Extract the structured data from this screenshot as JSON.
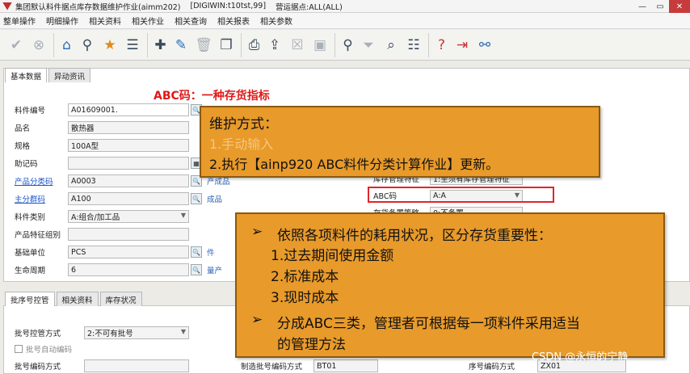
{
  "window": {
    "title": "集团默认料件据点库存数据维护作业(aimm202)",
    "db": "[DIGIWIN:t10tst,99]",
    "site": "营运据点:ALL(ALL)",
    "minimize": "—",
    "restore": "▭",
    "close": "✕"
  },
  "menu": [
    "整单操作",
    "明细操作",
    "相关资料",
    "相关作业",
    "相关查询",
    "相关报表",
    "相关参数"
  ],
  "toolbar_icons": [
    "check-icon",
    "cancel-icon",
    "home-icon",
    "pin-icon",
    "star-icon",
    "list-icon",
    "add-icon",
    "edit-icon",
    "delete-icon",
    "copy-icon",
    "print-icon",
    "export-icon",
    "excel-icon",
    "image-icon",
    "search-icon",
    "filter-icon",
    "query-icon",
    "tree-icon",
    "help-icon",
    "exit-icon",
    "attach-icon"
  ],
  "tabs": {
    "basic": "基本数据",
    "change": "异动资讯"
  },
  "annotation": "ABC码：一种存货指标",
  "fields": [
    {
      "label": "料件编号",
      "value": "A01609001."
    },
    {
      "label": "品名",
      "value": "散热器"
    },
    {
      "label": "规格",
      "value": "100A型"
    },
    {
      "label": "助记码",
      "value": ""
    },
    {
      "label": "产品分类码",
      "value": "A0003",
      "note": "产成品"
    },
    {
      "label": "主分群码",
      "value": "A100",
      "note": "成品"
    },
    {
      "label": "料件类别",
      "value": "A:组合/加工品"
    },
    {
      "label": "产品特征组别",
      "value": ""
    },
    {
      "label": "基础单位",
      "value": "PCS",
      "note": "件"
    },
    {
      "label": "生命周期",
      "value": "6",
      "note": "量产"
    }
  ],
  "right_fields": {
    "inventory_label": "库存管理特征",
    "inventory_value": "1:至须有库存管理特征",
    "abc_label": "ABC码",
    "abc_value": "A:A",
    "stock_label": "存货备置策略",
    "stock_value": "0:不备置"
  },
  "callout1": {
    "title": "维护方式：",
    "line1": "1.手动输入",
    "line2": "2.执行【ainp920 ABC料件分类计算作业】更新。"
  },
  "callout2": {
    "bullet1": "依照各项料件的耗用状况，区分存货重要性：",
    "item1": "1.过去期间使用金额",
    "item2": "2.标准成本",
    "item3": "3.现时成本",
    "bullet2a": "分成ABC三类，管理者可根据每一项料件采用适当",
    "bullet2b": "的管理方法"
  },
  "bottom_tabs": [
    "批序号控管",
    "相关资料",
    "库存状况"
  ],
  "bottom_fields": {
    "lot_control_label": "批号控管方式",
    "lot_control_value": "2:不可有批号",
    "lot_auto_label": "批号自动编码",
    "lot_encode_label": "批号编码方式",
    "make_lot_label": "制造批号编码方式",
    "make_lot_value": "BT01",
    "serial_label": "序号编码方式",
    "serial_value": "ZX01"
  },
  "watermark": "CSDN @永恒的宁静"
}
